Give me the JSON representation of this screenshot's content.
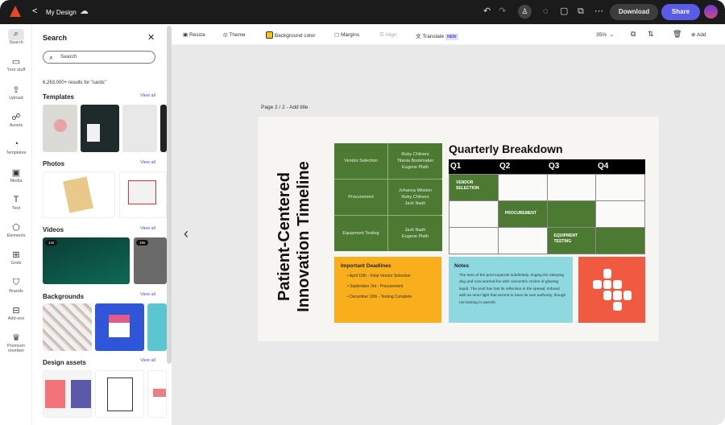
{
  "topbar": {
    "back": "<",
    "title": "My Design",
    "download": "Download",
    "share": "Share"
  },
  "rail": [
    {
      "icon": "search-icon",
      "glyph": "⌕",
      "label": "Search"
    },
    {
      "icon": "folder-icon",
      "glyph": "▭",
      "label": "Your stuff"
    },
    {
      "icon": "upload-icon",
      "glyph": "⇪",
      "label": "Upload"
    },
    {
      "icon": "assets-icon",
      "glyph": "☍",
      "label": "Assets"
    },
    {
      "icon": "templates-icon",
      "glyph": "◔",
      "label": "Templates"
    },
    {
      "icon": "media-icon",
      "glyph": "▣",
      "label": "Media"
    },
    {
      "icon": "text-icon",
      "glyph": "T",
      "label": "Text"
    },
    {
      "icon": "elements-icon",
      "glyph": "⬠",
      "label": "Elements"
    },
    {
      "icon": "grids-icon",
      "glyph": "⊞",
      "label": "Grids"
    },
    {
      "icon": "brands-icon",
      "glyph": "⛉",
      "label": "Brands"
    },
    {
      "icon": "addons-icon",
      "glyph": "⊟",
      "label": "Add-ons"
    },
    {
      "icon": "crown-icon",
      "glyph": "♛",
      "label": "Premium member"
    }
  ],
  "panel": {
    "title": "Search",
    "search_placeholder": "Search",
    "results": "6,263,000+ results for \"cards\"",
    "view_all": "View all",
    "sections": [
      "Templates",
      "Photos",
      "Videos",
      "Backgrounds",
      "Design assets"
    ],
    "video_durations": [
      "14s",
      "19s"
    ]
  },
  "toolbar": {
    "resize": "Resize",
    "theme": "Theme",
    "bg": "Background color",
    "margins": "Margins",
    "align": "Align",
    "translate": "Translate",
    "new": "NEW",
    "zoom": "35%",
    "add": "Add"
  },
  "page": {
    "label": "Page 2 / 2 - ",
    "add_title": "Add title",
    "vertical_title": "Patient-Centered Innovation Timeline",
    "team": [
      {
        "phase": "Vendor Selection",
        "people": "Ruby Chilvers\nTitania Bookmaker\nEugene Plath"
      },
      {
        "phase": "Procurement",
        "people": "Johanna Milstein\nRuby Chilvers\nJack Nash"
      },
      {
        "phase": "Equipment Testing",
        "people": "Jack Nash\nEugene Plath"
      }
    ],
    "quarterly": {
      "title": "Quarterly Breakdown",
      "headers": [
        "Q1",
        "Q2",
        "Q3",
        "Q4"
      ],
      "labels": [
        "VENDOR SELECTION",
        "PROCUREMENT",
        "EQUIPMENT TESTING"
      ]
    },
    "deadlines": {
      "title": "Important Deadlines",
      "items": [
        "April 15th - Final Vendor Selection",
        "September 3rd - Procurement",
        "December 10th - Testing Complete"
      ]
    },
    "notes": {
      "title": "Notes",
      "text": "The hem of the pool expands indefinitely, ringing the sleeping dog and now worried fox with concentric circles of glowing liquid. The pool has lost its reflection in the spread, imbued with an inner light that seems to have its own authority, though not lacking in warmth."
    }
  },
  "colors": {
    "green": "#4c7a32",
    "orange": "#f9ae1b",
    "cyan": "#8ed8e0",
    "red": "#f05a40",
    "accent": "#5b5bea"
  }
}
